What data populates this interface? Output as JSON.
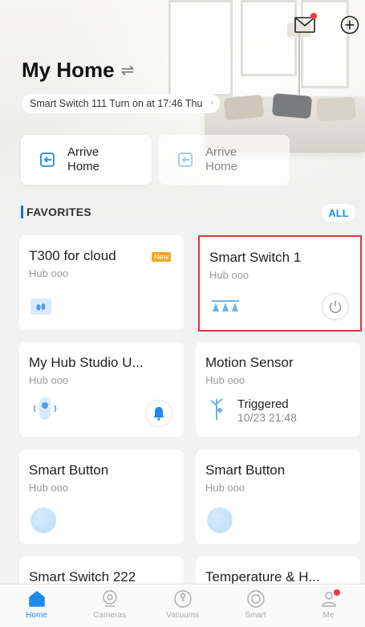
{
  "header": {
    "title": "My Home",
    "switch_icon": "swap-icon",
    "activity": "Smart Switch 111 Turn on at 17:46 Thu",
    "icons": [
      "mail-icon",
      "add-circle-icon"
    ]
  },
  "scenes": [
    {
      "label_line1": "Arrive",
      "label_line2": "Home",
      "icon": "arrive-home-icon",
      "enabled": true
    },
    {
      "label_line1": "Arrive",
      "label_line2": "Home",
      "icon": "arrive-home-icon",
      "enabled": false
    }
  ],
  "favorites": {
    "title": "FAVORITES",
    "all_label": "ALL",
    "devices": [
      {
        "name": "T300 for cloud",
        "sub": "Hub ooo",
        "badge": "New",
        "icon": "footprint-sensor-icon"
      },
      {
        "name": "Smart Switch 1",
        "sub": "Hub ooo",
        "icon": "triple-switch-icon",
        "action": "power-icon"
      },
      {
        "name": "My Hub Studio U...",
        "sub": "Hub ooo",
        "icon": "hub-studio-icon",
        "action": "bell-icon"
      },
      {
        "name": "Motion Sensor",
        "sub": "Hub ooo",
        "icon": "motion-sensor-icon",
        "status": "Triggered",
        "time": "10/23 21:48"
      },
      {
        "name": "Smart Button",
        "sub": "Hub ooo",
        "icon": "button-icon"
      },
      {
        "name": "Smart Button",
        "sub": "Hub ooo",
        "icon": "button-icon"
      },
      {
        "name": "Smart Switch 222",
        "sub": "",
        "icon": ""
      },
      {
        "name": "Temperature & H...",
        "sub": "",
        "icon": ""
      }
    ]
  },
  "nav": [
    {
      "label": "Home",
      "icon": "home-icon",
      "active": true
    },
    {
      "label": "Cameras",
      "icon": "camera-icon",
      "active": false
    },
    {
      "label": "Vacuums",
      "icon": "vacuum-icon",
      "active": false
    },
    {
      "label": "Smart",
      "icon": "smart-icon",
      "active": false
    },
    {
      "label": "Me",
      "icon": "user-icon",
      "active": false
    }
  ],
  "colors": {
    "accent": "#1f8bf0",
    "alert": "#ef3b3b",
    "selected_outline": "#d93a3a",
    "badge": "#f5a623"
  }
}
